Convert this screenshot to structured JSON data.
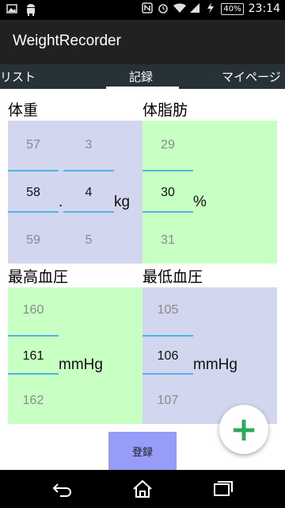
{
  "status_bar": {
    "left_icons": [
      "image-icon",
      "android-icon"
    ],
    "right_icons": [
      "nfc-icon",
      "alarm-icon",
      "wifi-icon",
      "signal-4g-icon",
      "charging-icon"
    ],
    "battery": "40%",
    "time": "23:14"
  },
  "app": {
    "title": "WeightRecorder"
  },
  "tabs": {
    "left": "リスト",
    "center": "記録",
    "right": "マイページ",
    "selected": "記録"
  },
  "weight": {
    "label": "体重",
    "int_prev": "57",
    "int_sel": "58",
    "int_next": "59",
    "dec_prev": "3",
    "dec_sel": "4",
    "dec_next": "5",
    "separator": ".",
    "unit": "kg"
  },
  "body_fat": {
    "label": "体脂肪",
    "prev": "29",
    "sel": "30",
    "next": "31",
    "unit": "%"
  },
  "systolic": {
    "label": "最高血圧",
    "prev": "160",
    "sel": "161",
    "next": "162",
    "unit": "mmHg"
  },
  "diastolic": {
    "label": "最低血圧",
    "prev": "105",
    "sel": "106",
    "next": "107",
    "unit": "mmHg"
  },
  "actions": {
    "add": "+",
    "register": "登録"
  },
  "colors": {
    "blue_panel": "#d2d6ee",
    "green_panel": "#c8ffc2",
    "accent_line": "#4fb5e7",
    "register_button": "#979cf8",
    "fab_plus": "#2ea85a",
    "app_bar": "#212121",
    "tab_bar": "#263238"
  }
}
